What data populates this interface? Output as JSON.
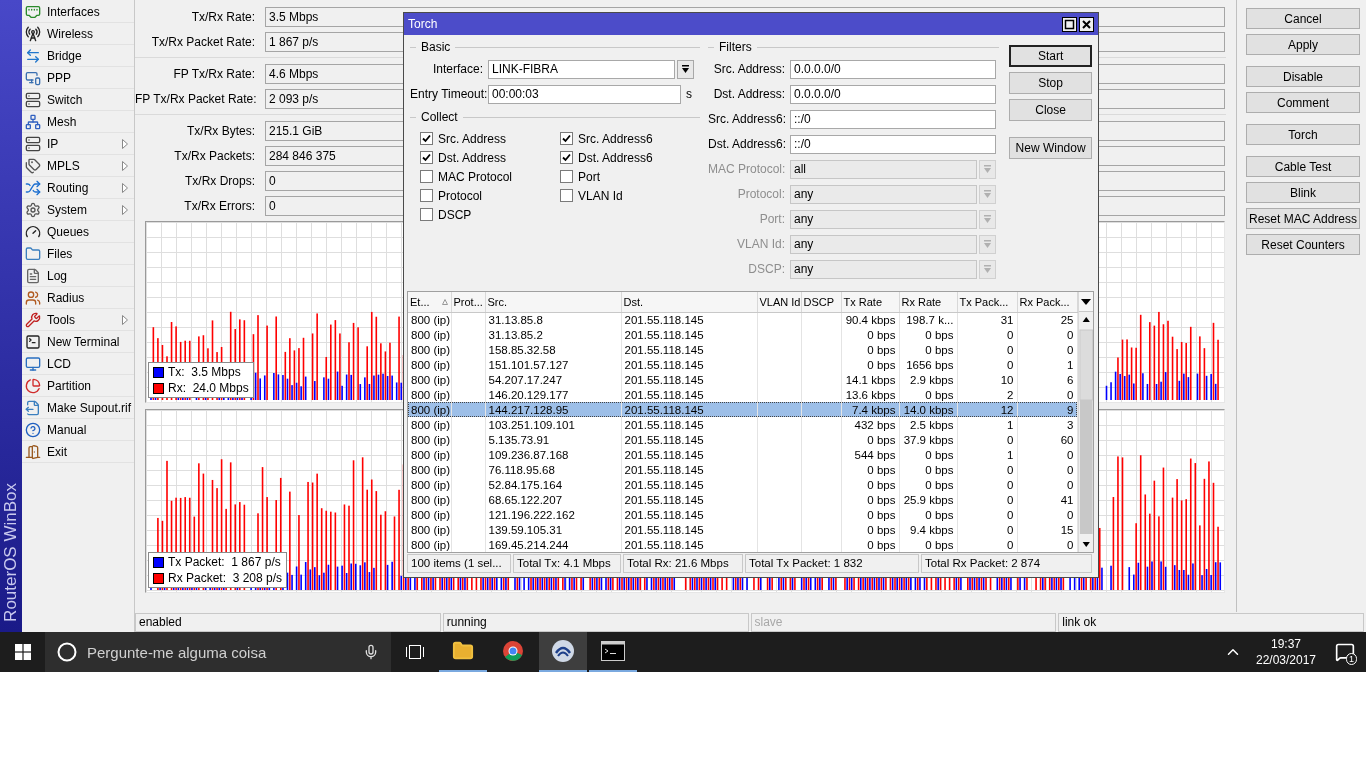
{
  "brand": {
    "text": "RouterOS WinBox"
  },
  "sidebar": {
    "items": [
      {
        "label": "Interfaces",
        "submenu": false
      },
      {
        "label": "Wireless",
        "submenu": false
      },
      {
        "label": "Bridge",
        "submenu": false
      },
      {
        "label": "PPP",
        "submenu": false
      },
      {
        "label": "Switch",
        "submenu": false
      },
      {
        "label": "Mesh",
        "submenu": false
      },
      {
        "label": "IP",
        "submenu": true
      },
      {
        "label": "MPLS",
        "submenu": true
      },
      {
        "label": "Routing",
        "submenu": true
      },
      {
        "label": "System",
        "submenu": true
      },
      {
        "label": "Queues",
        "submenu": false
      },
      {
        "label": "Files",
        "submenu": false
      },
      {
        "label": "Log",
        "submenu": false
      },
      {
        "label": "Radius",
        "submenu": false
      },
      {
        "label": "Tools",
        "submenu": true
      },
      {
        "label": "New Terminal",
        "submenu": false
      },
      {
        "label": "LCD",
        "submenu": false
      },
      {
        "label": "Partition",
        "submenu": false
      },
      {
        "label": "Make Supout.rif",
        "submenu": false
      },
      {
        "label": "Manual",
        "submenu": false
      },
      {
        "label": "Exit",
        "submenu": false
      }
    ]
  },
  "interface_window": {
    "stats": [
      [
        {
          "label": "Tx/Rx Rate:",
          "value": "3.5 Mbps"
        },
        {
          "label": "Tx/Rx Packet Rate:",
          "value": "1 867 p/s"
        }
      ],
      [
        {
          "label": "FP Tx/Rx Rate:",
          "value": "4.6 Mbps"
        },
        {
          "label": "FP Tx/Rx Packet Rate:",
          "value": "2 093 p/s"
        }
      ],
      [
        {
          "label": "Tx/Rx Bytes:",
          "value": "215.1 GiB"
        },
        {
          "label": "Tx/Rx Packets:",
          "value": "284 846 375"
        },
        {
          "label": "Tx/Rx Drops:",
          "value": "0"
        },
        {
          "label": "Tx/Rx Errors:",
          "value": "0"
        }
      ]
    ],
    "graphs": [
      {
        "legend": [
          {
            "text": "Tx:  3.5 Mbps",
            "color": "#0000ff"
          },
          {
            "text": "Rx:  24.0 Mbps",
            "color": "#ff0000"
          }
        ]
      },
      {
        "legend": [
          {
            "text": "Tx Packet:  1 867 p/s",
            "color": "#0000ff"
          },
          {
            "text": "Rx Packet:  3 208 p/s",
            "color": "#ff0000"
          }
        ]
      }
    ],
    "buttons": [
      [
        "Cancel",
        "Apply"
      ],
      [
        "Disable",
        "Comment"
      ],
      [
        "Torch"
      ],
      [
        "Cable Test",
        "Blink",
        "Reset MAC Address",
        "Reset Counters"
      ]
    ],
    "status_bar": [
      {
        "text": "enabled",
        "disabled": false
      },
      {
        "text": "running",
        "disabled": false
      },
      {
        "text": "slave",
        "disabled": true
      },
      {
        "text": "link ok",
        "disabled": false
      }
    ]
  },
  "torch": {
    "title": "Torch",
    "basic": {
      "title": "Basic",
      "fields": [
        {
          "label": "Interface:",
          "value": "LINK-FIBRA",
          "kind": "select"
        },
        {
          "label": "Entry Timeout:",
          "value": "00:00:03",
          "kind": "text",
          "unit": "s"
        }
      ]
    },
    "collect": {
      "title": "Collect",
      "columns": [
        [
          {
            "label": "Src. Address",
            "checked": true
          },
          {
            "label": "Dst. Address",
            "checked": true
          },
          {
            "label": "MAC Protocol",
            "checked": false
          },
          {
            "label": "Protocol",
            "checked": false
          },
          {
            "label": "DSCP",
            "checked": false
          }
        ],
        [
          {
            "label": "Src. Address6",
            "checked": true
          },
          {
            "label": "Dst. Address6",
            "checked": true
          },
          {
            "label": "Port",
            "checked": false
          },
          {
            "label": "VLAN Id",
            "checked": false
          }
        ]
      ]
    },
    "filters": {
      "title": "Filters",
      "fields": [
        {
          "label": "Src. Address:",
          "value": "0.0.0.0/0",
          "kind": "text",
          "disabled": false
        },
        {
          "label": "Dst. Address:",
          "value": "0.0.0.0/0",
          "kind": "text",
          "disabled": false
        },
        {
          "label": "Src. Address6:",
          "value": "::/0",
          "kind": "text",
          "disabled": false
        },
        {
          "label": "Dst. Address6:",
          "value": "::/0",
          "kind": "text",
          "disabled": false
        },
        {
          "label": "MAC Protocol:",
          "value": "all",
          "kind": "select",
          "disabled": true
        },
        {
          "label": "Protocol:",
          "value": "any",
          "kind": "select",
          "disabled": true
        },
        {
          "label": "Port:",
          "value": "any",
          "kind": "select",
          "disabled": true
        },
        {
          "label": "VLAN Id:",
          "value": "any",
          "kind": "select",
          "disabled": true
        },
        {
          "label": "DSCP:",
          "value": "any",
          "kind": "select",
          "disabled": true
        }
      ]
    },
    "buttons": [
      {
        "label": "Start",
        "default": true
      },
      {
        "label": "Stop",
        "default": false
      },
      {
        "label": "Close",
        "default": false
      },
      {
        "label": "New Window",
        "default": false
      }
    ],
    "table": {
      "columns": [
        "Et...",
        "Prot...",
        "Src.",
        "Dst.",
        "VLAN Id",
        "DSCP",
        "Tx Rate",
        "Rx Rate",
        "Tx Pack...",
        "Rx Pack..."
      ],
      "rows": [
        {
          "ether_type": "800 (ip)",
          "src": "31.13.85.8",
          "dst": "201.55.118.145",
          "tx_rate": "90.4 kbps",
          "rx_rate": "198.7 k...",
          "tx_packets": "31",
          "rx_packets": "25",
          "selected": false
        },
        {
          "ether_type": "800 (ip)",
          "src": "31.13.85.2",
          "dst": "201.55.118.145",
          "tx_rate": "0 bps",
          "rx_rate": "0 bps",
          "tx_packets": "0",
          "rx_packets": "0",
          "selected": false
        },
        {
          "ether_type": "800 (ip)",
          "src": "158.85.32.58",
          "dst": "201.55.118.145",
          "tx_rate": "0 bps",
          "rx_rate": "0 bps",
          "tx_packets": "0",
          "rx_packets": "0",
          "selected": false
        },
        {
          "ether_type": "800 (ip)",
          "src": "151.101.57.127",
          "dst": "201.55.118.145",
          "tx_rate": "0 bps",
          "rx_rate": "1656 bps",
          "tx_packets": "0",
          "rx_packets": "1",
          "selected": false
        },
        {
          "ether_type": "800 (ip)",
          "src": "54.207.17.247",
          "dst": "201.55.118.145",
          "tx_rate": "14.1 kbps",
          "rx_rate": "2.9 kbps",
          "tx_packets": "10",
          "rx_packets": "6",
          "selected": false
        },
        {
          "ether_type": "800 (ip)",
          "src": "146.20.129.177",
          "dst": "201.55.118.145",
          "tx_rate": "13.6 kbps",
          "rx_rate": "0 bps",
          "tx_packets": "2",
          "rx_packets": "0",
          "selected": false
        },
        {
          "ether_type": "800 (ip)",
          "src": "144.217.128.95",
          "dst": "201.55.118.145",
          "tx_rate": "7.4 kbps",
          "rx_rate": "14.0 kbps",
          "tx_packets": "12",
          "rx_packets": "9",
          "selected": true
        },
        {
          "ether_type": "800 (ip)",
          "src": "103.251.109.101",
          "dst": "201.55.118.145",
          "tx_rate": "432 bps",
          "rx_rate": "2.5 kbps",
          "tx_packets": "1",
          "rx_packets": "3",
          "selected": false
        },
        {
          "ether_type": "800 (ip)",
          "src": "5.135.73.91",
          "dst": "201.55.118.145",
          "tx_rate": "0 bps",
          "rx_rate": "37.9 kbps",
          "tx_packets": "0",
          "rx_packets": "60",
          "selected": false
        },
        {
          "ether_type": "800 (ip)",
          "src": "109.236.87.168",
          "dst": "201.55.118.145",
          "tx_rate": "544 bps",
          "rx_rate": "0 bps",
          "tx_packets": "1",
          "rx_packets": "0",
          "selected": false
        },
        {
          "ether_type": "800 (ip)",
          "src": "76.118.95.68",
          "dst": "201.55.118.145",
          "tx_rate": "0 bps",
          "rx_rate": "0 bps",
          "tx_packets": "0",
          "rx_packets": "0",
          "selected": false
        },
        {
          "ether_type": "800 (ip)",
          "src": "52.84.175.164",
          "dst": "201.55.118.145",
          "tx_rate": "0 bps",
          "rx_rate": "0 bps",
          "tx_packets": "0",
          "rx_packets": "0",
          "selected": false
        },
        {
          "ether_type": "800 (ip)",
          "src": "68.65.122.207",
          "dst": "201.55.118.145",
          "tx_rate": "0 bps",
          "rx_rate": "25.9 kbps",
          "tx_packets": "0",
          "rx_packets": "41",
          "selected": false
        },
        {
          "ether_type": "800 (ip)",
          "src": "121.196.222.162",
          "dst": "201.55.118.145",
          "tx_rate": "0 bps",
          "rx_rate": "0 bps",
          "tx_packets": "0",
          "rx_packets": "0",
          "selected": false
        },
        {
          "ether_type": "800 (ip)",
          "src": "139.59.105.31",
          "dst": "201.55.118.145",
          "tx_rate": "0 bps",
          "rx_rate": "9.4 kbps",
          "tx_packets": "0",
          "rx_packets": "15",
          "selected": false
        },
        {
          "ether_type": "800 (ip)",
          "src": "169.45.214.244",
          "dst": "201.55.118.145",
          "tx_rate": "0 bps",
          "rx_rate": "0 bps",
          "tx_packets": "0",
          "rx_packets": "0",
          "selected": false
        }
      ]
    },
    "status_bar": [
      "100 items (1 sel...",
      "Total Tx: 4.1 Mbps",
      "Total Rx: 21.6 Mbps",
      "Total Tx Packet: 1 832",
      "Total Rx Packet: 2 874"
    ]
  },
  "taskbar": {
    "search": {
      "placeholder": "Pergunte-me alguma coisa"
    },
    "apps": [
      {
        "running": true,
        "active": false
      },
      {
        "running": false,
        "active": false
      },
      {
        "running": true,
        "active": true
      },
      {
        "running": true,
        "active": false
      }
    ],
    "clock": {
      "time": "19:37",
      "date": "22/03/2017"
    },
    "notifications": {
      "count": "1"
    }
  }
}
